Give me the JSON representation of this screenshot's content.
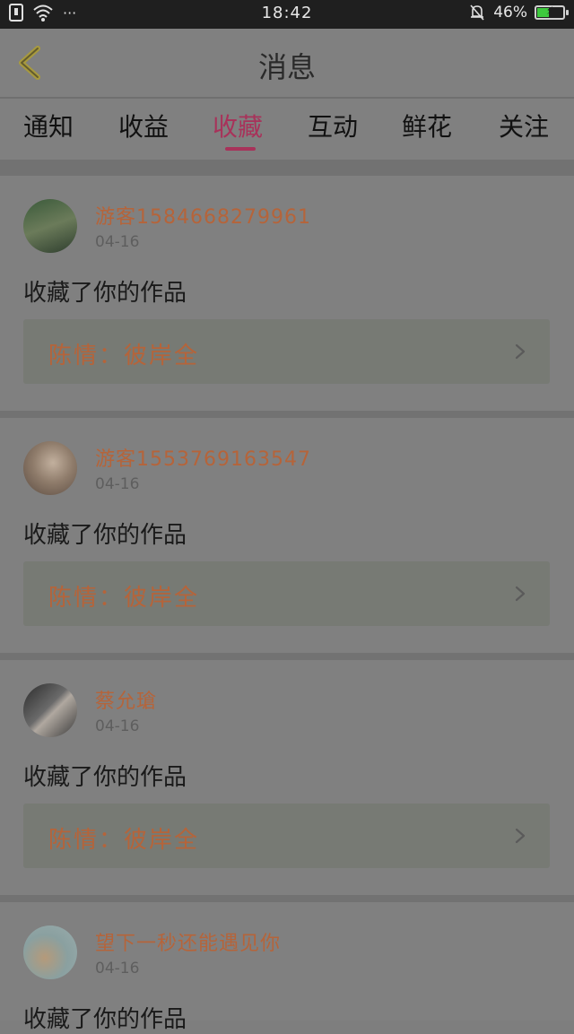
{
  "status_bar": {
    "time": "18:42",
    "battery": "46%",
    "battery_level": 0.46,
    "signal_extra": "···"
  },
  "header": {
    "title": "消息"
  },
  "tabs": [
    {
      "label": "通知"
    },
    {
      "label": "收益"
    },
    {
      "label": "收藏",
      "active": true
    },
    {
      "label": "互动"
    },
    {
      "label": "鲜花"
    },
    {
      "label": "关注"
    }
  ],
  "cards": [
    {
      "user": "游客1584668279961",
      "date": "04-16",
      "action": "收藏了你的作品",
      "work": "陈情：彼岸全",
      "avatar_colors": [
        "#3a5a3a",
        "#7c8a6a"
      ]
    },
    {
      "user": "游客1553769163547",
      "date": "04-16",
      "action": "收藏了你的作品",
      "work": "陈情：彼岸全",
      "avatar_colors": [
        "#a99a8a",
        "#6a5a4f"
      ]
    },
    {
      "user": "蔡允瑲",
      "date": "04-16",
      "action": "收藏了你的作品",
      "work": "陈情：彼岸全",
      "avatar_colors": [
        "#3a3a3a",
        "#9a9a9a"
      ]
    },
    {
      "user": "望下一秒还能遇见你",
      "date": "04-16",
      "action": "收藏了你的作品",
      "work": "",
      "avatar_colors": [
        "#8aa0a0",
        "#c09070"
      ]
    }
  ],
  "colors": {
    "accent": "#a8325a",
    "username": "#b5643a",
    "overlay": "#808080"
  }
}
